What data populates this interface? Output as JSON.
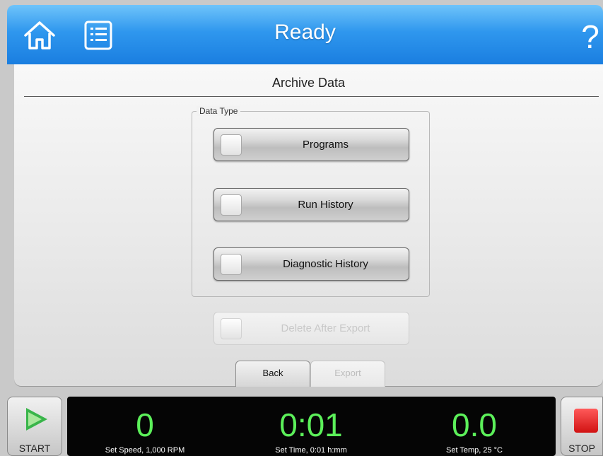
{
  "header": {
    "title": "Ready",
    "help_glyph": "?"
  },
  "panel": {
    "title": "Archive Data",
    "group_label": "Data Type",
    "options": [
      {
        "label": "Programs",
        "enabled": true
      },
      {
        "label": "Run History",
        "enabled": true
      },
      {
        "label": "Diagnostic History",
        "enabled": true
      }
    ],
    "delete_after_export": {
      "label": "Delete After Export",
      "enabled": false
    },
    "back_label": "Back",
    "export_label": "Export"
  },
  "status": {
    "start_label": "START",
    "stop_label": "STOP",
    "speed_value": "0",
    "speed_set": "Set Speed, 1,000 RPM",
    "time_value": "0:01",
    "time_set": "Set Time, 0:01 h:mm",
    "temp_value": "0.0",
    "temp_set": "Set Temp, 25 °C"
  },
  "colors": {
    "header_blue": "#2f97ee",
    "readout_green": "#5cf05a",
    "start_green": "#39b54a",
    "stop_red": "#d11212"
  }
}
